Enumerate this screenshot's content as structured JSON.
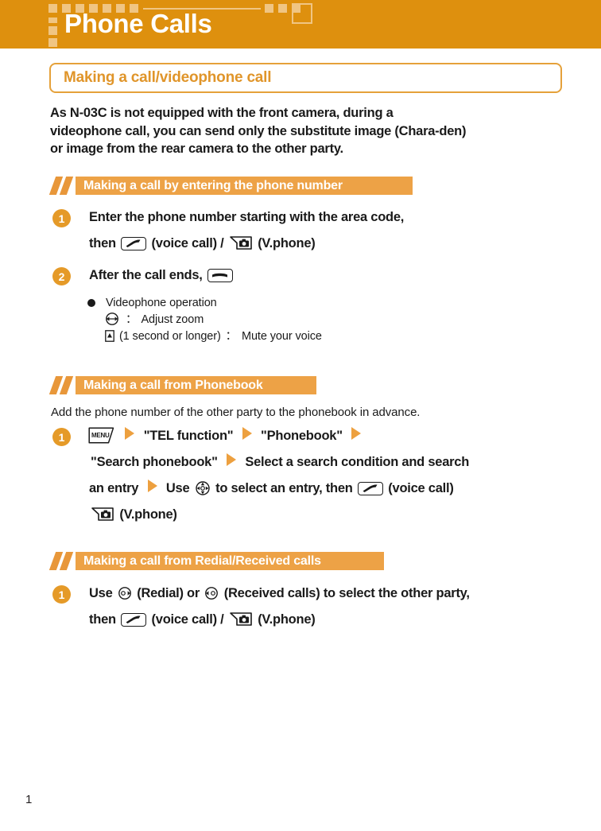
{
  "theme": {
    "header_bg": "#de900e",
    "header_accent": "#f0c583",
    "band_bg": "#eda246",
    "band_slash": "#e8973a",
    "badge_bg": "#e59a28",
    "title_border": "#e5a13a",
    "title_text": "#e0952a",
    "arrow_color": "#eda03f",
    "body_text": "#1a1a1a"
  },
  "header": {
    "title": "Phone Calls"
  },
  "title_box": {
    "text": "Making a call/videophone call"
  },
  "intro": {
    "line1": "As N-03C is not equipped with the front camera, during a",
    "line2": "videophone call, you can send only the substitute image (Chara-den)",
    "line3": "or image from the rear camera to the other party."
  },
  "sections": [
    {
      "heading": "Making a call by entering the phone number",
      "steps": [
        {
          "number": "1",
          "line1": "Enter the phone number starting with the area code,",
          "line2_pre": "then",
          "line2_mid": "(voice call) /",
          "line2_post": "(V.phone)"
        },
        {
          "number": "2",
          "line1_pre": "After the call ends,"
        }
      ],
      "note": {
        "title": "Videophone operation",
        "items": [
          {
            "label": "Adjust zoom",
            "qualifier": ""
          },
          {
            "label": "Mute your voice",
            "qualifier": "(1 second or longer)"
          }
        ]
      }
    },
    {
      "heading": "Making a call from Phonebook",
      "lead": "Add the phone number of the other party to the phonebook in advance.",
      "steps": [
        {
          "number": "1",
          "part_tel": "\"TEL function\"",
          "part_phonebook": "\"Phonebook\"",
          "part_search": "\"Search phonebook\"",
          "part_condition": "Select a search condition and search",
          "part_entry": "an entry",
          "part_use": "Use",
          "part_select": "to select an entry, then",
          "part_voice": "(voice call)",
          "part_vphone": "(V.phone)"
        }
      ]
    },
    {
      "heading": "Making a call from Redial/Received calls",
      "steps": [
        {
          "number": "1",
          "line1_pre": "Use",
          "line1_redial": "(Redial) or",
          "line1_received": "(Received calls) to select the other party,",
          "line2_pre": "then",
          "line2_mid": "(voice call) /",
          "line2_post": "(V.phone)"
        }
      ]
    }
  ],
  "icons": {
    "voice_call_key": "voice-call-key-icon",
    "end_call_key": "end-call-key-icon",
    "vphone_key": "videophone-key-icon",
    "menu_key": "menu-key-icon",
    "zoom_key": "zoom-adjust-key-icon",
    "mute_key": "mute-key-icon",
    "dpad_key": "dpad-key-icon",
    "redial_key": "redial-key-icon",
    "received_key": "received-calls-key-icon",
    "arrow": "arrow-right-icon",
    "bullet": "bullet-icon"
  },
  "footer": {
    "page_number": "1"
  }
}
